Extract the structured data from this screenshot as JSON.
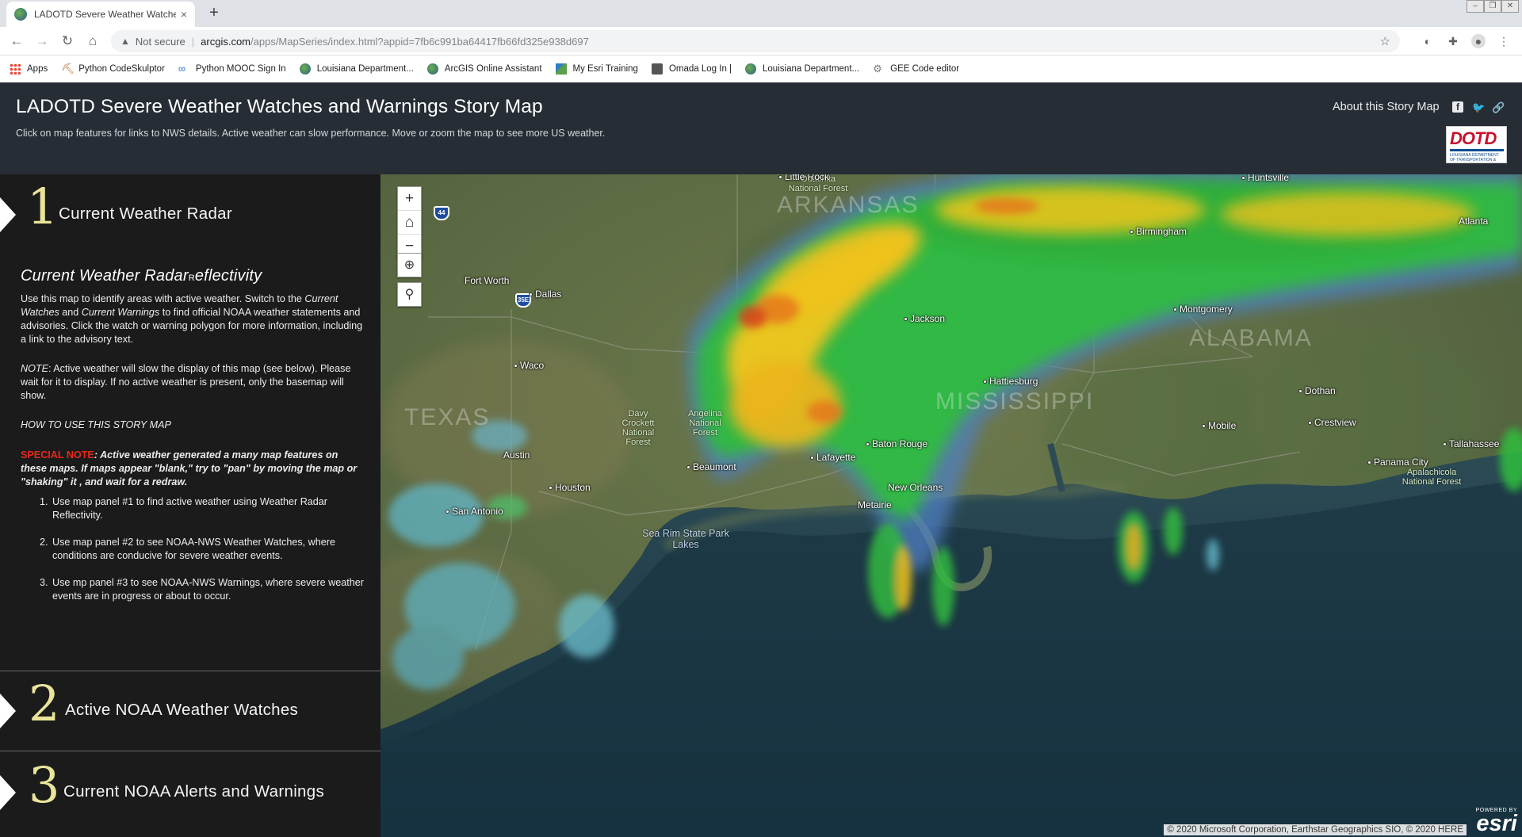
{
  "browser": {
    "tab_title": "LADOTD Severe Weather Watches and Warnings Story Map",
    "new_tab": "+",
    "close_tab": "×",
    "security_label": "Not secure",
    "url_host": "arcgis.com",
    "url_path": "/apps/MapSeries/index.html?appid=7fb6c991ba64417fb66fd325e938d697",
    "bookmarks": [
      {
        "label": "Apps",
        "icon": "apps-grid-icon"
      },
      {
        "label": "Python CodeSkulptor",
        "icon": "pickaxe-icon"
      },
      {
        "label": "Python MOOC Sign In",
        "icon": "coursera-icon"
      },
      {
        "label": "Louisiana Department...",
        "icon": "globe-icon"
      },
      {
        "label": "ArcGIS Online Assistant",
        "icon": "globe-icon"
      },
      {
        "label": "My Esri Training",
        "icon": "map-icon"
      },
      {
        "label": "Omada Log In |",
        "icon": "omada-icon"
      },
      {
        "label": "Louisiana Department...",
        "icon": "globe-icon"
      },
      {
        "label": "GEE Code editor",
        "icon": "gear-icon"
      }
    ]
  },
  "header": {
    "title": "LADOTD Severe Weather Watches and Warnings Story Map",
    "subtitle": "Click on map features for links to NWS details. Active weather can slow performance. Move or zoom the map to see more US weather.",
    "about_label": "About this Story Map",
    "logo_text": "DOTD",
    "logo_subtext": "LOUISIANA DEPARTMENT OF TRANSPORTATION & DEVELOPMENT"
  },
  "sidebar": {
    "sections": [
      {
        "number": "1",
        "title": "Current Weather Radar"
      },
      {
        "number": "2",
        "title": "Active NOAA Weather Watches"
      },
      {
        "number": "3",
        "title": "Current NOAA Alerts and Warnings"
      }
    ],
    "content": {
      "heading_main": "Current Weather Radar",
      "heading_small": "R",
      "heading_rest": "eflectivity",
      "intro_1": "Use this map to identify areas with active weather. Switch to the ",
      "intro_em1": "Current Watches",
      "intro_2": " and ",
      "intro_em2": "Current Warnings",
      "intro_3": " to find official NOAA weather statements and advisories. Click the watch or warning polygon for more information, including a link to the advisory text.",
      "note_label": "NOTE",
      "note_text": ": Active weather will slow the display of this map (see below). Please wait for it to display. If no active weather is present, only the basemap will show.",
      "howto": "HOW TO USE THIS STORY MAP",
      "special_label": "SPECIAL NOTE",
      "special_text": ": Active weather generated a many map features on these maps. If maps appear \"blank,\" try to \"pan\" by moving the map or \"shaking\" it , and wait for a redraw.",
      "steps": [
        "Use map panel #1 to find active weather using Weather Radar Reflectivity.",
        "Use map panel #2 to see NOAA-NWS Weather Watches, where conditions are conducive for severe weather events.",
        "Use mp panel #3 to see NOAA-NWS Warnings, where severe weather events are in progress or about to occur."
      ]
    }
  },
  "map": {
    "controls": {
      "zoom_in": "+",
      "home": "⌂",
      "zoom_out": "−"
    },
    "cities": [
      {
        "name": "Little Rock"
      },
      {
        "name": "Fort Worth"
      },
      {
        "name": "Dallas"
      },
      {
        "name": "Waco"
      },
      {
        "name": "Austin"
      },
      {
        "name": "San Antonio"
      },
      {
        "name": "Houston"
      },
      {
        "name": "Beaumont"
      },
      {
        "name": "Lafayette"
      },
      {
        "name": "Baton Rouge"
      },
      {
        "name": "New Orleans"
      },
      {
        "name": "Hattiesburg"
      },
      {
        "name": "Jackson"
      },
      {
        "name": "Montgomery"
      },
      {
        "name": "Birmingham"
      },
      {
        "name": "Huntsville"
      },
      {
        "name": "Mobile"
      },
      {
        "name": "Dothan"
      },
      {
        "name": "Crestview"
      },
      {
        "name": "Panama City"
      },
      {
        "name": "Tallahassee"
      },
      {
        "name": "Metairie"
      },
      {
        "name": "Atlanta"
      }
    ],
    "regions": [
      "ARKANSAS",
      "TEXAS",
      "MISSISSIPPI",
      "ALABAMA"
    ],
    "pois": [
      "Ouachita National Forest",
      "Davy Crockett National Forest",
      "Angelina National Forest",
      "Apalachicola National Forest"
    ],
    "water_label": "Sea Rim State Park Lakes",
    "highway_shields": [
      "44",
      "35E"
    ],
    "attribution": "© 2020 Microsoft Corporation, Earthstar Geographics SIO, © 2020 HERE",
    "powered_by": "POWERED BY",
    "esri_logo": "esri"
  }
}
